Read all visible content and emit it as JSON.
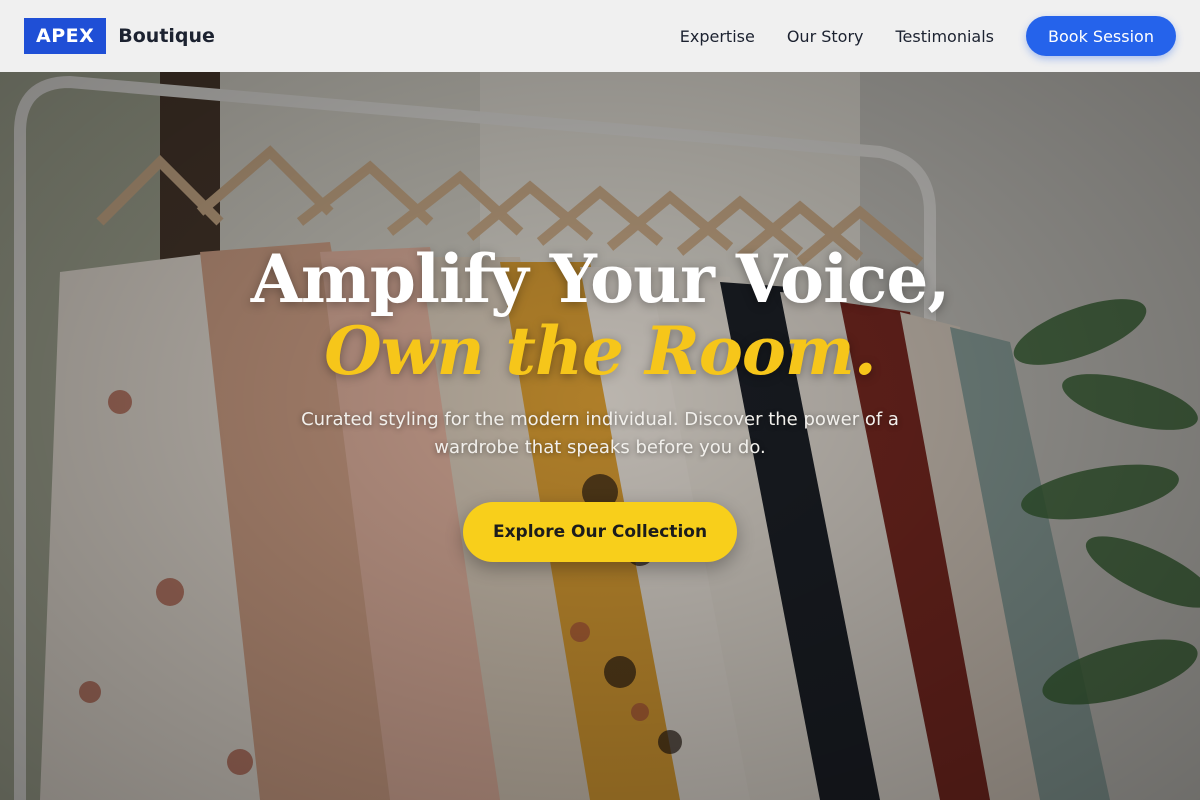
{
  "brand": {
    "logo_mark": "APEX",
    "logo_text": "Boutique"
  },
  "nav": {
    "links": [
      "Expertise",
      "Our Story",
      "Testimonials"
    ],
    "cta_label": "Book Session"
  },
  "hero": {
    "headline_line1": "Amplify Your Voice,",
    "headline_line2": "Own the Room.",
    "subtitle": "Curated styling for the modern individual. Discover the power of a wardrobe that speaks before you do.",
    "cta_label": "Explore Our Collection"
  },
  "colors": {
    "brand_blue": "#2563eb",
    "logo_blue": "#1f4fd6",
    "accent_yellow": "#f8cf1b",
    "headline_accent": "#f6c61a"
  }
}
